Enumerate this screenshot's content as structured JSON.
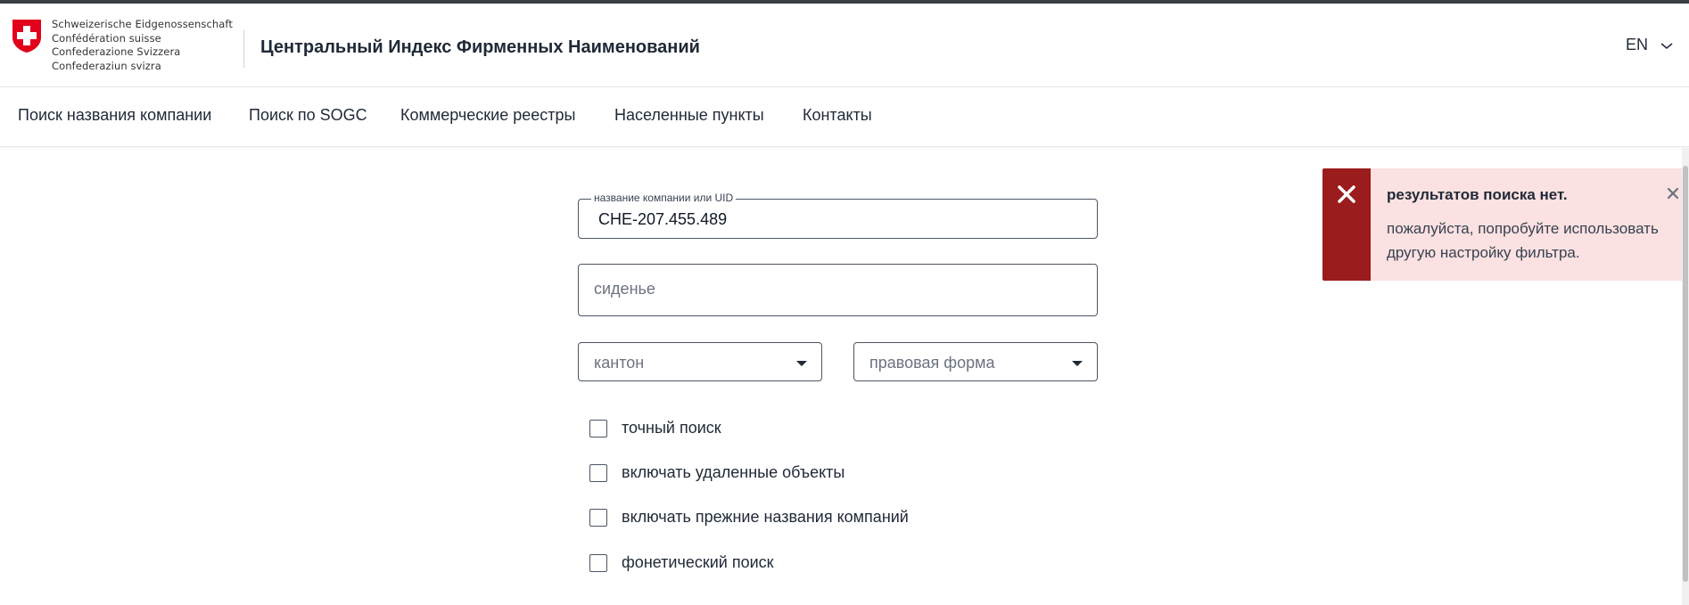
{
  "header": {
    "confederation_lines": [
      "Schweizerische Eidgenossenschaft",
      "Confédération suisse",
      "Confederazione Svizzera",
      "Confederaziun svizra"
    ],
    "title": "Центральный Индекс Фирменных Наименований",
    "language": "EN",
    "logo_icon": "swiss-cross-icon",
    "lang_icon": "chevron-down-icon"
  },
  "nav": {
    "items": [
      {
        "label": "Поиск названия компании"
      },
      {
        "label": "Поиск по SOGC"
      },
      {
        "label": "Коммерческие реестры"
      },
      {
        "label": "Населенные пункты"
      },
      {
        "label": "Контакты"
      }
    ]
  },
  "form": {
    "company": {
      "legend": "название компании или UID",
      "value": "CHE-207.455.489"
    },
    "seat": {
      "placeholder": "сиденье"
    },
    "canton": {
      "placeholder": "кантон"
    },
    "legal_form": {
      "placeholder": "правовая форма"
    },
    "checkboxes": [
      {
        "label": "точный поиск",
        "checked": false
      },
      {
        "label": "включать удаленные объекты",
        "checked": false
      },
      {
        "label": "включать прежние названия компаний",
        "checked": false
      },
      {
        "label": "фонетический поиск",
        "checked": false
      }
    ]
  },
  "toast": {
    "title": "результатов поиска нет.",
    "message": "пожалуйста, попробуйте использовать другую настройку фильтра.",
    "accent_color": "#9b1c1c",
    "background_color": "#fbe1e1",
    "status_icon": "error-x-icon",
    "close_icon": "close-icon"
  }
}
